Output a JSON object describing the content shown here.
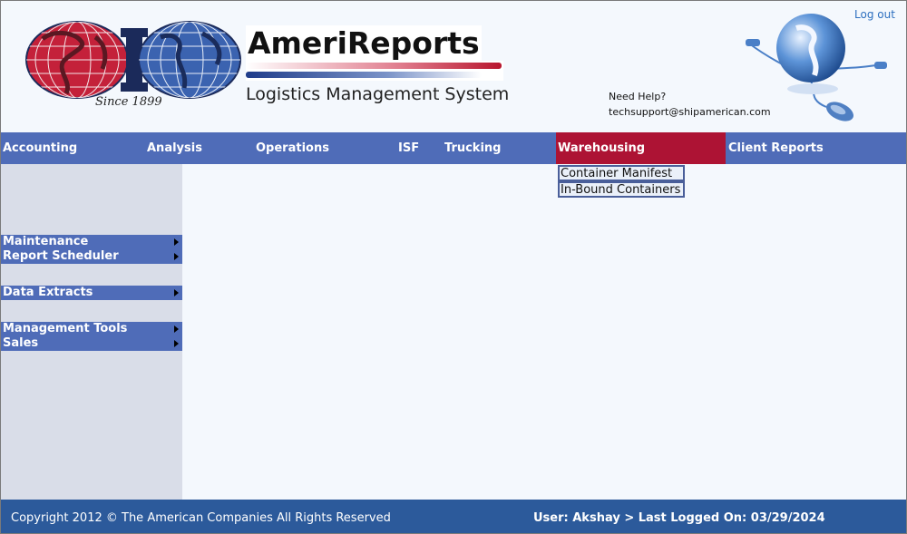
{
  "header": {
    "brand_title": "AmeriReports",
    "brand_subtitle": "Logistics Management System",
    "since": "Since 1899",
    "help_label": "Need Help?",
    "help_email": "techsupport@shipamerican.com",
    "logout": "Log out"
  },
  "nav": {
    "items": [
      {
        "label": "Accounting"
      },
      {
        "label": "Analysis"
      },
      {
        "label": "Operations"
      },
      {
        "label": "ISF"
      },
      {
        "label": "Trucking"
      },
      {
        "label": "Warehousing",
        "active": true
      },
      {
        "label": "Client Reports"
      }
    ],
    "active_color": "#ad1334",
    "bar_color": "#4f6cb8"
  },
  "dropdown": {
    "items": [
      {
        "label": "Container Manifest"
      },
      {
        "label": "In-Bound Containers"
      }
    ]
  },
  "sidebar": {
    "groups": [
      {
        "items": [
          {
            "label": "Maintenance"
          },
          {
            "label": "Report Scheduler"
          }
        ]
      },
      {
        "items": [
          {
            "label": "Data Extracts"
          }
        ]
      },
      {
        "items": [
          {
            "label": "Management Tools"
          },
          {
            "label": "Sales"
          }
        ]
      }
    ]
  },
  "footer": {
    "copyright": "Copyright 2012 © The American Companies All Rights Reserved",
    "user_info": "User: Akshay > Last Logged On: 03/29/2024",
    "color": "#2c5a9b"
  }
}
